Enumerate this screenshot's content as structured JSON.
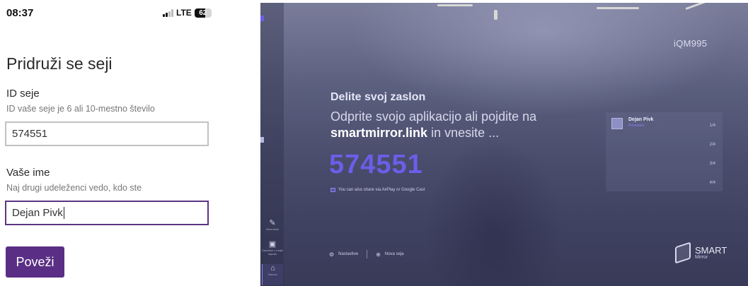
{
  "phone": {
    "status": {
      "time": "08:37",
      "network": "LTE",
      "battery": "62",
      "battery_level": 0.62
    },
    "title": "Pridruži se seji",
    "session_field": {
      "label": "ID seje",
      "hint": "ID vaše seje je 6 ali 10-mestno število",
      "value": "574551"
    },
    "name_field": {
      "label": "Vaše ime",
      "hint": "Naj drugi udeleženci vedo, kdo ste",
      "value": "Dejan Pivk"
    },
    "connect_button": "Poveži"
  },
  "mirror": {
    "device_id": "iQM995",
    "share_title": "Delite svoj zaslon",
    "share_line1": "Odprite svojo aplikacijo ali pojdite na",
    "share_link": "smartmirror.link",
    "share_line2_rest": " in vnesite ...",
    "session_code": "574551",
    "airplay_note": "You can also share via AirPlay or Google Cast",
    "participants": {
      "name": "Dejan Pivk",
      "status": "Povezano",
      "slots": [
        "1/4",
        "2/4",
        "3/4",
        "4/4"
      ]
    },
    "sidebar": [
      {
        "label": "Bela tabla",
        "icon": "edit-icon",
        "glyph": "✎"
      },
      {
        "label": "Datoteke z mojih naprav",
        "icon": "folder-icon",
        "glyph": "▣"
      },
      {
        "label": "Domov",
        "icon": "home-icon",
        "glyph": "⌂"
      }
    ],
    "bottom_actions": {
      "settings": "Nastavitve",
      "new_session": "Nova seja"
    },
    "logo": {
      "name": "SMART",
      "sub": "Mirror"
    },
    "accent_color": "#6a5fe8",
    "brand_color": "#5a2e84"
  }
}
